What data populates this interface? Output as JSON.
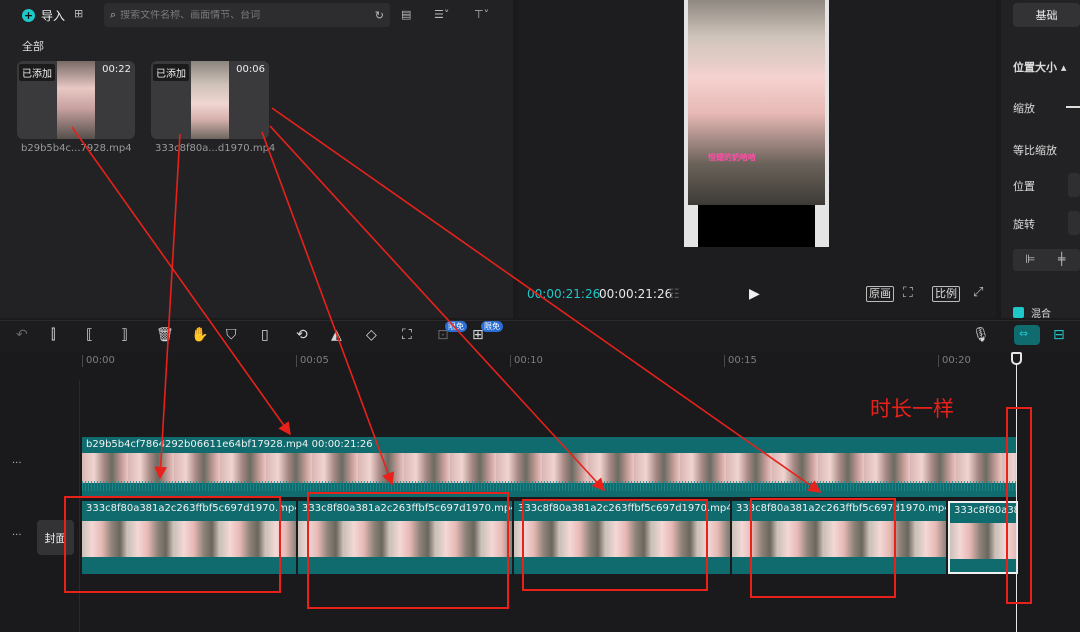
{
  "media": {
    "import_label": "导入",
    "search_placeholder": "搜索文件名称、画面情节、台词",
    "category": "全部",
    "items": [
      {
        "badge": "已添加",
        "duration": "00:22",
        "name": "b29b5b4c...7928.mp4"
      },
      {
        "badge": "已添加",
        "duration": "00:06",
        "name": "333c8f80a...d1970.mp4"
      }
    ]
  },
  "preview": {
    "caption": "恒翅的奶哈哈",
    "current_time": "00:00:21:26",
    "total_time": "00:00:21:26",
    "btn_original": "原画",
    "btn_ratio": "比例"
  },
  "props": {
    "tab_basic": "基础",
    "section_title": "位置大小",
    "scale_label": "缩放",
    "uniform_scale_label": "等比缩放",
    "position_label": "位置",
    "rotation_label": "旋转",
    "blend_label": "混合"
  },
  "toolbar": {
    "free_tag": "限免"
  },
  "ruler": {
    "ticks": [
      "00:00",
      "00:05",
      "00:10",
      "00:15",
      "00:20"
    ]
  },
  "tracks": {
    "cover_label": "封面",
    "top_clip": {
      "name": "b29b5b4cf7864292b06611e64bf17928.mp4",
      "duration": "00:00:21:26"
    },
    "bottom_clips": [
      "333c8f80a381a2c263ffbf5c697d1970.mp4",
      "333c8f80a381a2c263ffbf5c697d1970.mp4",
      "333c8f80a381a2c263ffbf5c697d1970.mp4",
      "333c8f80a381a2c263ffbf5c697d1970.mp4",
      "333c8f80a38"
    ]
  },
  "annotation": {
    "text": "时长一样",
    "color": "#e8211b"
  },
  "colors": {
    "accent": "#1ec7c8",
    "clip": "#0f6b6d"
  }
}
